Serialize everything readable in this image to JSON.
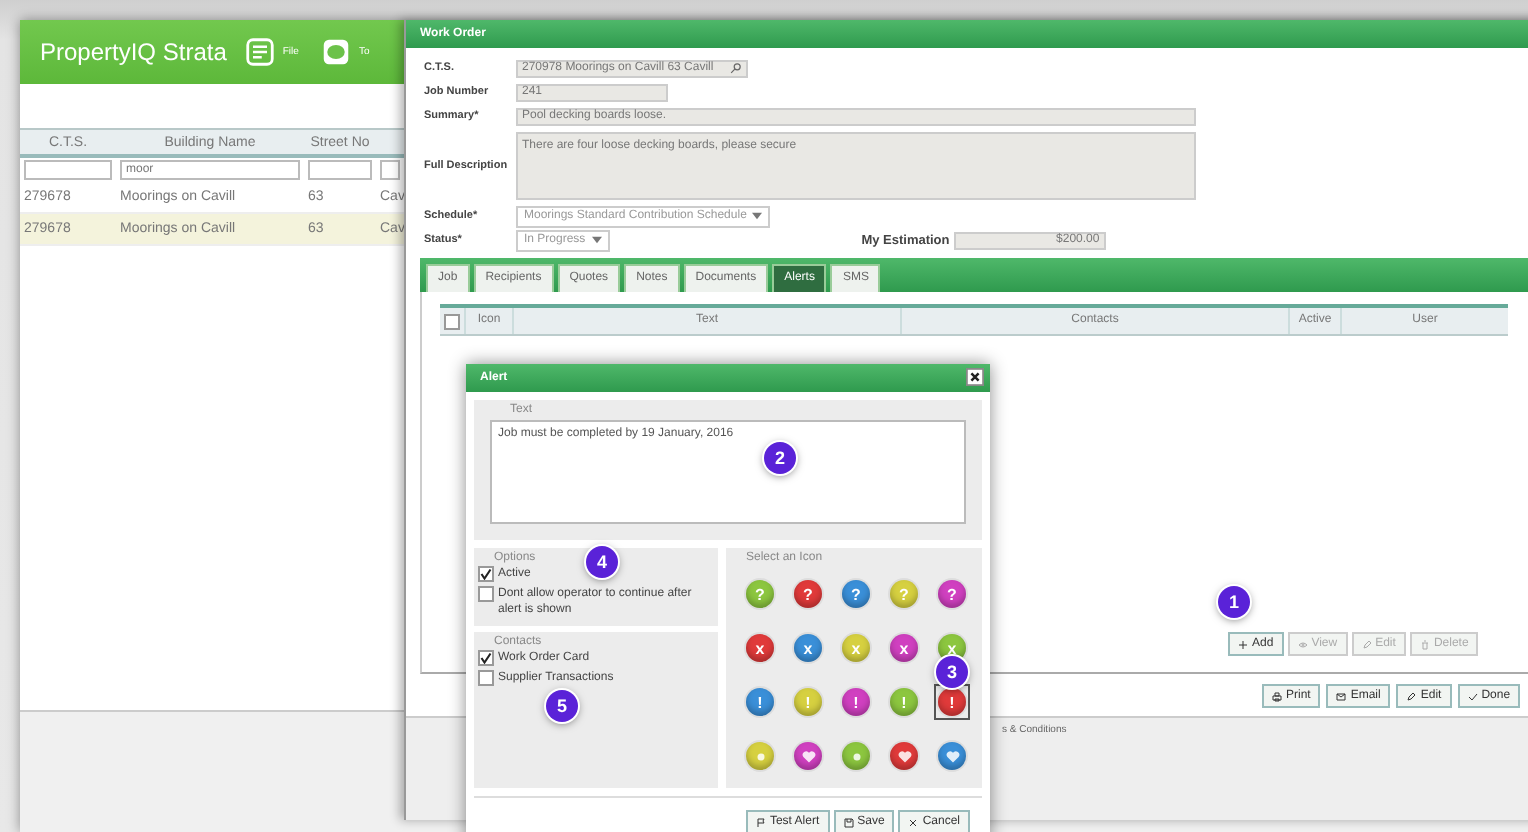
{
  "app": {
    "logo": "PropertyIQ Strata",
    "toolbar": [
      {
        "label": "File"
      },
      {
        "label": "To"
      }
    ]
  },
  "grid": {
    "columns": [
      {
        "label": "C.T.S."
      },
      {
        "label": "Building Name",
        "filter": "moor"
      },
      {
        "label": "Street No"
      },
      {}
    ],
    "rows": [
      {
        "cells": [
          "279678",
          "Moorings on Cavill",
          "63",
          "Cav"
        ],
        "selected": false
      },
      {
        "cells": [
          "279678",
          "Moorings on Cavill",
          "63",
          "Cav"
        ],
        "selected": true
      }
    ]
  },
  "work_order": {
    "title": "Work Order",
    "cts": {
      "label": "C.T.S.",
      "value": "270978 Moorings on Cavill 63 Cavill"
    },
    "job_number": {
      "label": "Job Number",
      "value": "241"
    },
    "summary": {
      "label": "Summary*",
      "value": "Pool decking boards loose."
    },
    "description": {
      "label": "Full Description",
      "value": "There are four loose decking boards, please secure"
    },
    "schedule": {
      "label": "Schedule*",
      "value": "Moorings Standard Contribution Schedule"
    },
    "status": {
      "label": "Status*",
      "value": "In Progress"
    },
    "estimation": {
      "label": "My Estimation",
      "value": "$200.00"
    },
    "tabs": [
      {
        "label": "Job",
        "selected": false
      },
      {
        "label": "Recipients",
        "selected": false
      },
      {
        "label": "Quotes",
        "selected": false
      },
      {
        "label": "Notes",
        "selected": false
      },
      {
        "label": "Documents",
        "selected": false
      },
      {
        "label": "Alerts",
        "selected": true
      },
      {
        "label": "SMS",
        "selected": false
      }
    ],
    "select_all": {
      "checked": false
    },
    "alert_columns": [
      "Icon",
      "Text",
      "Contacts",
      "Active",
      "User"
    ],
    "actions": [
      {
        "label": "Add",
        "disabled": false
      },
      {
        "label": "View",
        "disabled": true
      },
      {
        "label": "Edit",
        "disabled": true
      },
      {
        "label": "Delete",
        "disabled": true
      }
    ],
    "footer_buttons": [
      {
        "label": "Print"
      },
      {
        "label": "Email"
      },
      {
        "label": "Edit"
      },
      {
        "label": "Done"
      }
    ],
    "footer_text": "s & Conditions"
  },
  "alert": {
    "title": "Alert",
    "text_legend": "Text",
    "text": "Job must be completed by 19 January, 2016",
    "options_legend": "Options",
    "options": [
      {
        "label": "Active",
        "checked": true
      },
      {
        "label": "Dont allow operator to continue after alert is shown",
        "checked": false
      }
    ],
    "contacts_legend": "Contacts",
    "contacts": [
      {
        "label": "Work Order Card",
        "checked": true
      },
      {
        "label": "Supplier Transactions",
        "checked": false
      }
    ],
    "icons_legend": "Select an Icon",
    "icons": [
      {
        "kind": "glyph",
        "glyph": "?",
        "color": "#8cc63f",
        "selected": false
      },
      {
        "kind": "glyph",
        "glyph": "?",
        "color": "#e03a3a",
        "selected": false
      },
      {
        "kind": "glyph",
        "glyph": "?",
        "color": "#3a8fd8",
        "selected": false
      },
      {
        "kind": "glyph",
        "glyph": "?",
        "color": "#d6d040",
        "selected": false
      },
      {
        "kind": "glyph",
        "glyph": "?",
        "color": "#d040c0",
        "selected": false
      },
      {
        "kind": "glyph",
        "glyph": "x",
        "color": "#e03a3a",
        "selected": false
      },
      {
        "kind": "glyph",
        "glyph": "x",
        "color": "#3a8fd8",
        "selected": false
      },
      {
        "kind": "glyph",
        "glyph": "x",
        "color": "#d6d040",
        "selected": false
      },
      {
        "kind": "glyph",
        "glyph": "x",
        "color": "#d040c0",
        "selected": false
      },
      {
        "kind": "glyph",
        "glyph": "x",
        "color": "#8cc63f",
        "selected": false
      },
      {
        "kind": "glyph",
        "glyph": "!",
        "color": "#3a8fd8",
        "selected": false
      },
      {
        "kind": "glyph",
        "glyph": "!",
        "color": "#d6d040",
        "selected": false
      },
      {
        "kind": "glyph",
        "glyph": "!",
        "color": "#d040c0",
        "selected": false
      },
      {
        "kind": "glyph",
        "glyph": "!",
        "color": "#8cc63f",
        "selected": false
      },
      {
        "kind": "glyph",
        "glyph": "!",
        "color": "#e03a3a",
        "selected": true
      },
      {
        "kind": "dot",
        "color": "#d6d040",
        "selected": false
      },
      {
        "kind": "heart",
        "color": "#d040c0",
        "selected": false
      },
      {
        "kind": "dot",
        "color": "#8cc63f",
        "selected": false
      },
      {
        "kind": "heart",
        "color": "#e03a3a",
        "selected": false
      },
      {
        "kind": "heart",
        "color": "#3a8fd8",
        "selected": false
      }
    ],
    "buttons": [
      {
        "label": "Test Alert"
      },
      {
        "label": "Save"
      },
      {
        "label": "Cancel"
      }
    ]
  },
  "callouts": [
    "1",
    "2",
    "3",
    "4",
    "5"
  ]
}
